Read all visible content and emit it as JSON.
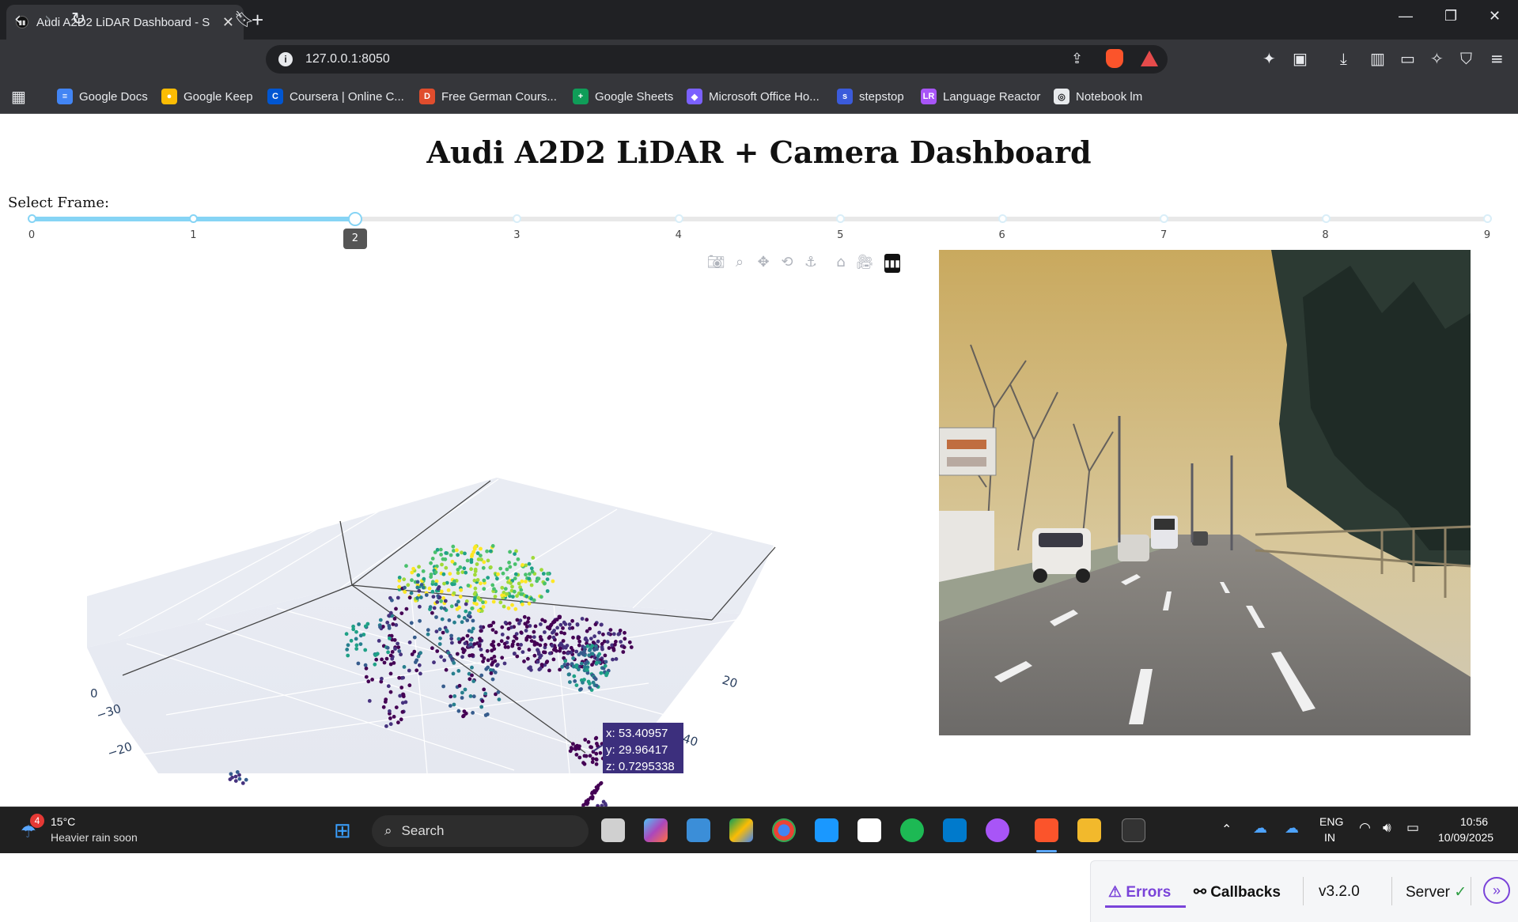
{
  "browser": {
    "tab_title": "Audi A2D2 LiDAR Dashboard - S",
    "url": "127.0.0.1:8050",
    "new_tab": "+",
    "window_controls": {
      "minimize": "—",
      "restore": "❐",
      "close": "✕"
    }
  },
  "bookmarks": [
    {
      "label": "Google Docs",
      "color": "#4285f4",
      "glyph": "≡"
    },
    {
      "label": "Google Keep",
      "color": "#fbbc04",
      "glyph": "●"
    },
    {
      "label": "Coursera | Online C...",
      "color": "#0056d2",
      "glyph": "C"
    },
    {
      "label": "Free German Cours...",
      "color": "#e04d2d",
      "glyph": "D"
    },
    {
      "label": "Google Sheets",
      "color": "#0f9d58",
      "glyph": "+"
    },
    {
      "label": "Microsoft Office Ho...",
      "color": "#7b61ff",
      "glyph": "◆"
    },
    {
      "label": "stepstop",
      "color": "#3b5bdb",
      "glyph": "s"
    },
    {
      "label": "Language Reactor",
      "color": "#a855f7",
      "glyph": "LR"
    },
    {
      "label": "Notebook lm",
      "color": "#e8eaed",
      "glyph": "◎"
    }
  ],
  "page": {
    "title": "Audi A2D2 LiDAR + Camera Dashboard",
    "frame_label": "Select Frame:",
    "slider": {
      "min": 0,
      "max": 9,
      "value": 2,
      "marks": [
        "0",
        "1",
        "2",
        "3",
        "4",
        "5",
        "6",
        "7",
        "8",
        "9"
      ]
    }
  },
  "plot": {
    "modebar": [
      "camera-icon",
      "zoom-icon",
      "pan-icon",
      "orbit-icon",
      "turntable-icon",
      "home-icon",
      "camera-view-icon",
      "plotly-logo"
    ],
    "axis_ticks": {
      "left": [
        "0",
        "−30",
        "−20"
      ],
      "right": [
        "20",
        "40"
      ]
    },
    "hover": {
      "x": "x: 53.40957",
      "y": "y: 29.96417",
      "z": "z: 0.7295338"
    }
  },
  "dash_debug": {
    "errors": "Errors",
    "callbacks": "Callbacks",
    "version": "v3.2.0",
    "server": "Server"
  },
  "taskbar": {
    "weather_badge": "4",
    "temperature": "15°C",
    "weather_text": "Heavier rain soon",
    "search": "Search",
    "lang_top": "ENG",
    "lang_bottom": "IN",
    "time": "10:56",
    "date": "10/09/2025"
  }
}
